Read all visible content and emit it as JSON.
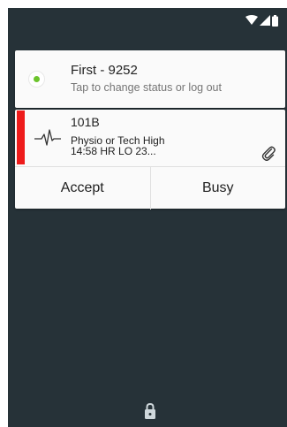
{
  "status_card": {
    "title": "First - 9252",
    "subtitle": "Tap to change status or log out",
    "status_color": "#6cc42c"
  },
  "alert_card": {
    "room": "101B",
    "line1": "Physio or Tech High",
    "line2": "14:58 HR LO 23...",
    "priority_color": "#ee1b1b",
    "icon": "ekg-icon",
    "attachment_icon": "paperclip-icon"
  },
  "actions": {
    "accept_label": "Accept",
    "busy_label": "Busy"
  },
  "statusbar": {
    "icons": [
      "wifi-icon",
      "signal-icon",
      "battery-icon"
    ]
  },
  "lock_icon": "lock-icon",
  "colors": {
    "background": "#263238",
    "card": "#fafafa"
  }
}
